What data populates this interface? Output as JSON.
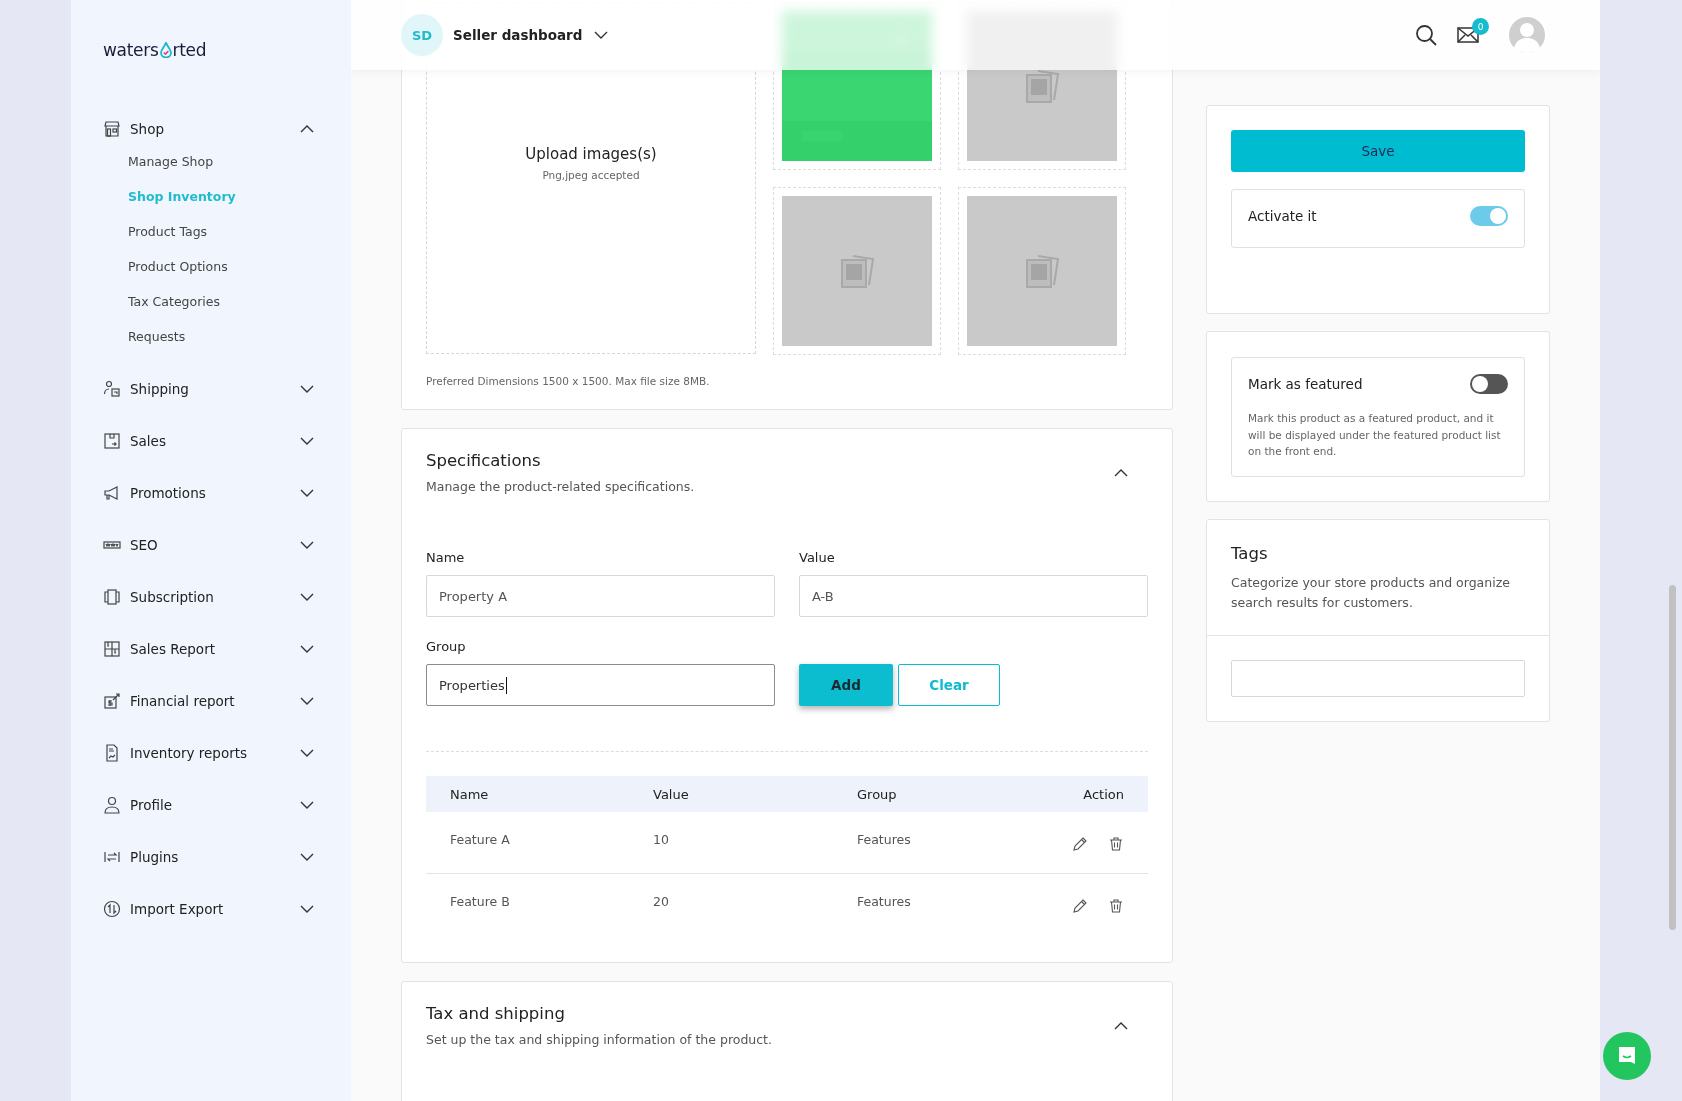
{
  "sidebar": {
    "logo": {
      "before": "waters",
      "after": "rted"
    },
    "items": [
      {
        "label": "Shop",
        "expanded": true,
        "children": [
          {
            "label": "Manage Shop",
            "selected": false
          },
          {
            "label": "Shop Inventory",
            "selected": true
          },
          {
            "label": "Product Tags",
            "selected": false
          },
          {
            "label": "Product Options",
            "selected": false
          },
          {
            "label": "Tax Categories",
            "selected": false
          },
          {
            "label": "Requests",
            "selected": false
          }
        ]
      },
      {
        "label": "Shipping",
        "expanded": false
      },
      {
        "label": "Sales",
        "expanded": false
      },
      {
        "label": "Promotions",
        "expanded": false
      },
      {
        "label": "SEO",
        "expanded": false
      },
      {
        "label": "Subscription",
        "expanded": false
      },
      {
        "label": "Sales Report",
        "expanded": false
      },
      {
        "label": "Financial report",
        "expanded": false
      },
      {
        "label": "Inventory reports",
        "expanded": false
      },
      {
        "label": "Profile",
        "expanded": false
      },
      {
        "label": "Plugins",
        "expanded": false
      },
      {
        "label": "Import Export",
        "expanded": false
      }
    ]
  },
  "header": {
    "initials": "SD",
    "title": "Seller dashboard",
    "notification_count": "0"
  },
  "media": {
    "upload_title": "Upload images(s)",
    "upload_hint": "Png,jpeg accepted",
    "thumbnails": [
      {
        "kind": "picture"
      },
      {
        "kind": "placeholder"
      },
      {
        "kind": "placeholder"
      },
      {
        "kind": "placeholder"
      }
    ],
    "note": "Preferred Dimensions 1500 x 1500. Max file size 8MB."
  },
  "specifications": {
    "title": "Specifications",
    "subtitle": "Manage the product-related specifications.",
    "expanded": true,
    "fields": [
      {
        "label": "Name",
        "value": "Property A",
        "focused": false
      },
      {
        "label": "Value",
        "value": "A-B",
        "focused": false
      },
      {
        "label": "Group",
        "value": "Properties",
        "focused": true
      }
    ],
    "buttons": [
      {
        "label": "Add",
        "kind": "primary"
      },
      {
        "label": "Clear",
        "kind": "outline"
      }
    ],
    "table": {
      "columns": [
        "Name",
        "Value",
        "Group",
        "Action"
      ],
      "rows": [
        {
          "cells": [
            "Feature A",
            "10",
            "Features"
          ]
        },
        {
          "cells": [
            "Feature B",
            "20",
            "Features"
          ]
        }
      ]
    }
  },
  "tax_shipping": {
    "title": "Tax and shipping",
    "subtitle": "Set up the tax and shipping information of the product.",
    "expanded": true
  },
  "publish": {
    "save": "Save",
    "activate": {
      "label": "Activate it",
      "on": true
    }
  },
  "featured": {
    "label": "Mark as featured",
    "on": false,
    "description": "Mark this product as a featured product, and it will be displayed under the featured product list on the front end."
  },
  "tags": {
    "title": "Tags",
    "description": "Categorize your store products and organize search results for customers."
  }
}
